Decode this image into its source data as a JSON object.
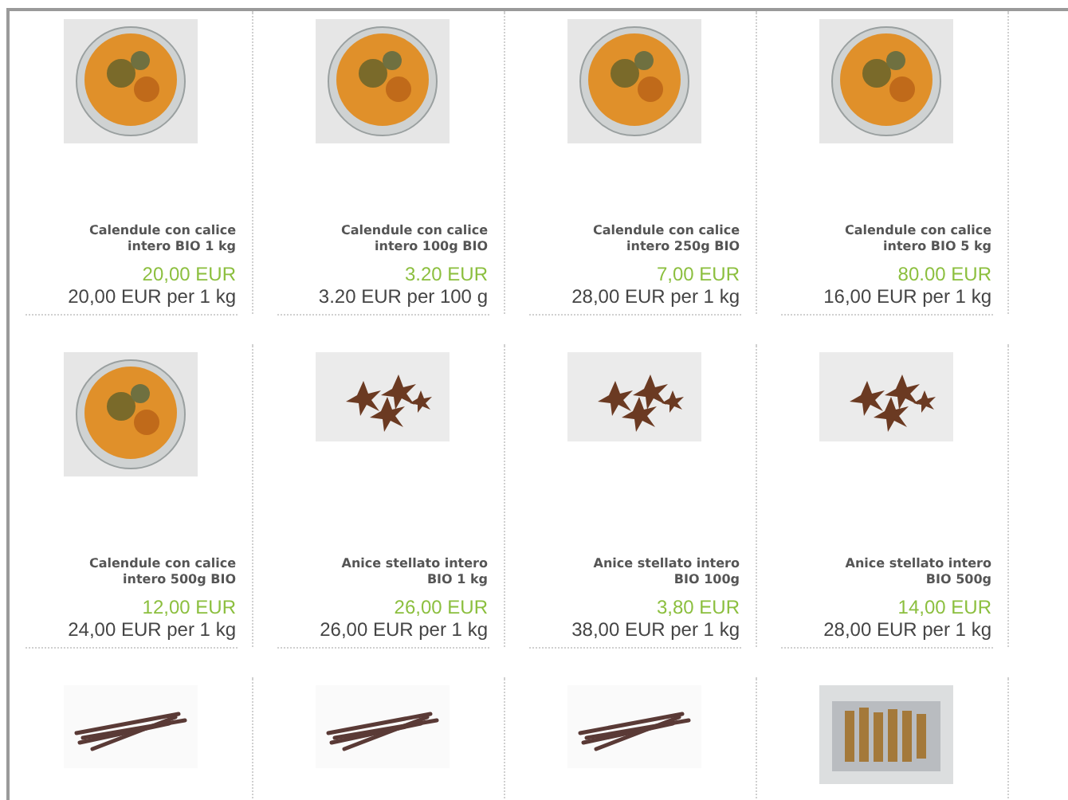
{
  "products": [
    {
      "kind": "calendula",
      "name": "Calendule con calice intero BIO 1 kg",
      "price": "20,00 EUR",
      "unit_price": "20,00 EUR per 1 kg"
    },
    {
      "kind": "calendula",
      "name": "Calendule con calice intero 100g BIO",
      "price": "3.20 EUR",
      "unit_price": "3.20 EUR per 100 g"
    },
    {
      "kind": "calendula",
      "name": "Calendule con calice intero 250g BIO",
      "price": "7,00 EUR",
      "unit_price": "28,00 EUR per 1 kg"
    },
    {
      "kind": "calendula",
      "name": "Calendule con calice intero BIO 5 kg",
      "price": "80.00 EUR",
      "unit_price": "16,00 EUR per 1 kg"
    },
    {
      "kind": "calendula",
      "name": "Calendule con calice intero 500g BIO",
      "price": "12,00 EUR",
      "unit_price": "24,00 EUR per 1 kg"
    },
    {
      "kind": "anise",
      "name": "Anice stellato intero BIO 1 kg",
      "price": "26,00 EUR",
      "unit_price": "26,00 EUR per 1 kg"
    },
    {
      "kind": "anise",
      "name": "Anice stellato intero BIO 100g",
      "price": "3,80 EUR",
      "unit_price": "38,00 EUR per 1 kg"
    },
    {
      "kind": "anise",
      "name": "Anice stellato intero BIO 500g",
      "price": "14,00 EUR",
      "unit_price": "28,00 EUR per 1 kg"
    },
    {
      "kind": "vanilla"
    },
    {
      "kind": "vanilla"
    },
    {
      "kind": "vanilla"
    },
    {
      "kind": "cinnamon_bag"
    }
  ]
}
